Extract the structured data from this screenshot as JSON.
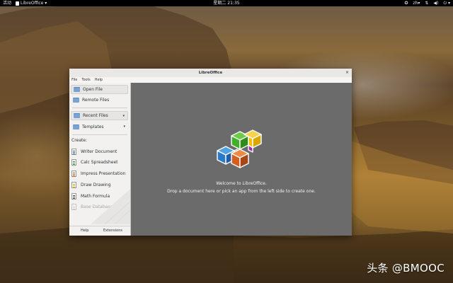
{
  "topbar": {
    "activities": "活动",
    "app_name": "LibreOffice",
    "app_arrow": "▾",
    "clock": "星期二 21:35",
    "input_method": "zh",
    "input_arrow": "▾",
    "icons": [
      "accessibility-icon",
      "input-method-icon",
      "network-icon",
      "volume-icon",
      "power-icon"
    ],
    "menu_arrow": "▾"
  },
  "window": {
    "title": "LibreOffice",
    "close_glyph": "×",
    "menu": [
      "File",
      "Tools",
      "Help"
    ]
  },
  "sidebar": {
    "open_file": "Open File",
    "remote_files": "Remote Files",
    "recent_files": "Recent Files",
    "templates": "Templates",
    "dropdown_arrow": "▾",
    "create_label": "Create:",
    "apps": [
      {
        "label": "Writer Document",
        "color": "#2a6bbf"
      },
      {
        "label": "Calc Spreadsheet",
        "color": "#2a9e3a"
      },
      {
        "label": "Impress Presentation",
        "color": "#d2601a"
      },
      {
        "label": "Draw Drawing",
        "color": "#e8b400"
      },
      {
        "label": "Math Formula",
        "color": "#444444"
      },
      {
        "label": "Base Database",
        "color": "#9b3aa5"
      }
    ],
    "help": "Help",
    "extensions": "Extensions"
  },
  "main": {
    "welcome": "Welcome to LibreOffice.",
    "hint": "Drop a document here or pick an app from the left side to create one."
  },
  "colors": {
    "logo_green": "#43b02a",
    "logo_yellow": "#f4c000",
    "logo_blue": "#2a7ac8",
    "logo_orange": "#d35f20",
    "logo_purple": "#9a2db0",
    "logo_cyan": "#1fa0c8"
  },
  "watermark": "头条 @BMOOC"
}
